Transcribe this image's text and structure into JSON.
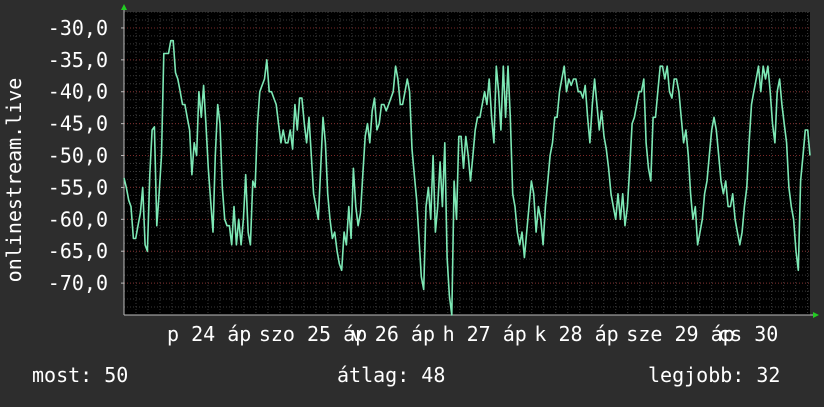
{
  "chart_data": {
    "type": "line",
    "ylabel": "onlinestream.live",
    "ylim": [
      -75,
      -27.5
    ],
    "yticks": [
      "-30,0",
      "-35,0",
      "-40,0",
      "-45,0",
      "-50,0",
      "-55,0",
      "-60,0",
      "-65,0",
      "-70,0"
    ],
    "ytick_values": [
      -30,
      -35,
      -40,
      -45,
      -50,
      -55,
      -60,
      -65,
      -70
    ],
    "xticks": [
      "p 24 áp",
      "szo 25 áp",
      "v 26 áp",
      "h 27 áp",
      "k 28 áp",
      "sze 29 áp",
      "cs 30"
    ],
    "grid": true,
    "series": [
      {
        "color": "#7de8b5",
        "values": [
          -53.5,
          -55,
          -57,
          -58,
          -63,
          -63,
          -61,
          -59,
          -55,
          -64,
          -65,
          -53,
          -46,
          -45.5,
          -61,
          -56,
          -50,
          -34,
          -34,
          -34,
          -32,
          -32,
          -37,
          -38,
          -40,
          -42,
          -42,
          -44,
          -46,
          -53,
          -48,
          -50,
          -40,
          -44,
          -39,
          -45,
          -52,
          -57,
          -62,
          -50,
          -42,
          -45,
          -55,
          -60,
          -61,
          -61,
          -64,
          -58,
          -64,
          -60,
          -64,
          -60,
          -53,
          -62,
          -64,
          -54,
          -55,
          -45,
          -40,
          -39,
          -38,
          -35,
          -40,
          -40,
          -41,
          -42,
          -45,
          -48,
          -46,
          -48,
          -48,
          -46,
          -49,
          -42,
          -46,
          -41,
          -41,
          -45,
          -48,
          -44,
          -50,
          -56,
          -58,
          -60,
          -52,
          -44,
          -48,
          -56,
          -60,
          -63,
          -62,
          -65,
          -67,
          -68,
          -62,
          -64,
          -58,
          -63,
          -52,
          -58,
          -61,
          -59,
          -53,
          -47,
          -45,
          -48,
          -43,
          -41,
          -46,
          -45,
          -42,
          -42,
          -43,
          -42,
          -41,
          -40,
          -36,
          -38,
          -42,
          -42,
          -40,
          -38,
          -40,
          -49,
          -53,
          -57,
          -63,
          -69,
          -71,
          -58,
          -55,
          -60,
          -50,
          -62,
          -58,
          -51,
          -58,
          -48,
          -66,
          -72,
          -75,
          -54,
          -60,
          -47,
          -47,
          -52,
          -47,
          -50,
          -54,
          -50,
          -46,
          -44,
          -44,
          -42,
          -40,
          -42,
          -38,
          -44,
          -48,
          -36,
          -40,
          -46,
          -36,
          -44,
          -36,
          -44,
          -56,
          -58,
          -62,
          -64,
          -62,
          -66,
          -62,
          -58,
          -54,
          -56,
          -62,
          -58,
          -60,
          -64,
          -58,
          -54,
          -50,
          -48,
          -44,
          -44,
          -40,
          -38,
          -36,
          -40,
          -38,
          -39,
          -38,
          -38,
          -40,
          -40,
          -41,
          -39,
          -44,
          -48,
          -42,
          -38,
          -42,
          -46,
          -43,
          -47,
          -49,
          -52,
          -56,
          -58,
          -60,
          -56,
          -60,
          -56,
          -61,
          -58,
          -52,
          -45,
          -44,
          -42,
          -40,
          -40,
          -38,
          -48,
          -52,
          -54,
          -44,
          -44,
          -40,
          -36,
          -36,
          -38,
          -36,
          -40,
          -41,
          -38,
          -38,
          -40,
          -44,
          -48,
          -46,
          -50,
          -56,
          -60,
          -58,
          -64,
          -62,
          -60,
          -56,
          -54,
          -50,
          -46,
          -44,
          -46,
          -50,
          -54,
          -56,
          -54,
          -58,
          -58,
          -56,
          -60,
          -62,
          -64,
          -62,
          -58,
          -55,
          -48,
          -42,
          -40,
          -38,
          -36,
          -40,
          -36,
          -38,
          -36,
          -40,
          -45,
          -48,
          -40,
          -38,
          -42,
          -45,
          -48,
          -55,
          -58,
          -60,
          -65,
          -68,
          -54,
          -50,
          -46,
          -46,
          -50
        ]
      }
    ]
  },
  "footer": {
    "current": "most: 50",
    "average": "átlag: 48",
    "best": "legjobb: 32"
  },
  "colors": {
    "background": "#2d2d2d",
    "plot_background": "#000000",
    "line": "#7de8b5",
    "grid_major": "#7a2a2a",
    "grid_minor": "#3a3a3a",
    "axis_arrow": "#22cc22"
  }
}
